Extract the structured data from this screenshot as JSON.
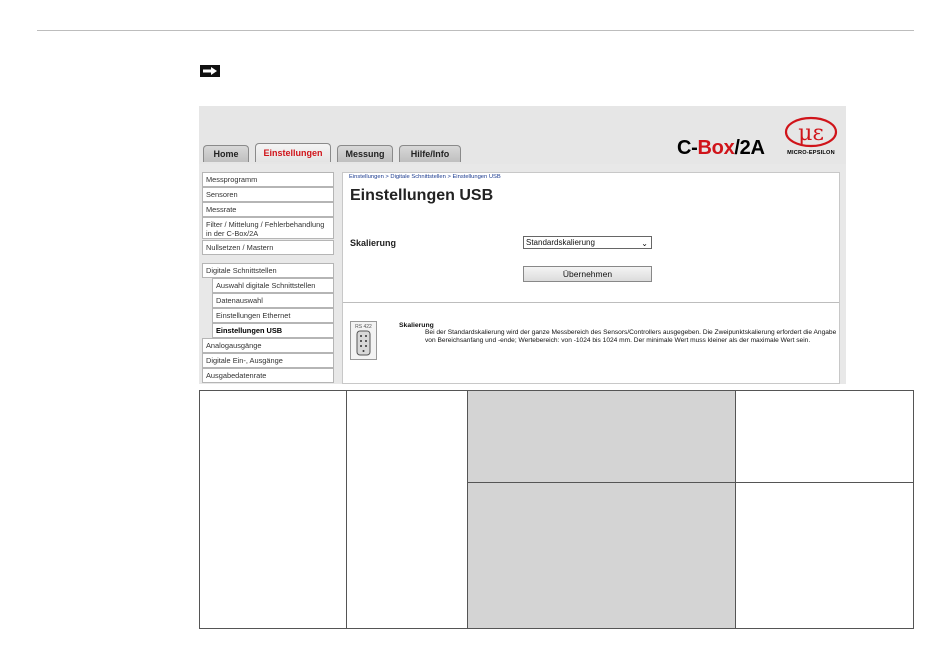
{
  "app": {
    "tabs": [
      {
        "label": "Home"
      },
      {
        "label": "Einstellungen"
      },
      {
        "label": "Messung"
      },
      {
        "label": "Hilfe/Info"
      }
    ],
    "brand": {
      "prefix": "C-",
      "highlight": "Box",
      "suffix": "/2A"
    },
    "logo_text": "MICRO-EPSILON"
  },
  "sidebar": {
    "items": [
      {
        "label": "Messprogramm"
      },
      {
        "label": "Sensoren"
      },
      {
        "label": "Messrate"
      },
      {
        "label": "Filter / Mittelung / Fehlerbehandlung in der C-Box/2A"
      },
      {
        "label": "Nullsetzen / Mastern"
      },
      {
        "label": "Digitale Schnittstellen"
      },
      {
        "label": "Auswahl digitale Schnittstellen"
      },
      {
        "label": "Datenauswahl"
      },
      {
        "label": "Einstellungen Ethernet"
      },
      {
        "label": "Einstellungen USB"
      },
      {
        "label": "Analogausgänge"
      },
      {
        "label": "Digitale Ein-, Ausgänge"
      },
      {
        "label": "Ausgabedatenrate"
      }
    ]
  },
  "main": {
    "breadcrumb": "Einstellungen > Digitale Schnittstellen > Einstellungen USB",
    "title": "Einstellungen USB",
    "scaling_label": "Skalierung",
    "scaling_value": "Standardskalierung",
    "apply_label": "Übernehmen",
    "connector_label": "RS 422",
    "help_title": "Skalierung",
    "help_text": "Bei der Standardskalierung wird der ganze Messbereich des Sensors/Controllers ausgegeben. Die Zweipunktskalierung erfordert die Angabe von Bereichsanfang und -ende; Wertebereich: von -1024 bis 1024 mm. Der minimale Wert muss kleiner als der maximale Wert sein."
  },
  "colors": {
    "accent_red": "#d0141a",
    "cell_gray": "#d4d4d4"
  }
}
